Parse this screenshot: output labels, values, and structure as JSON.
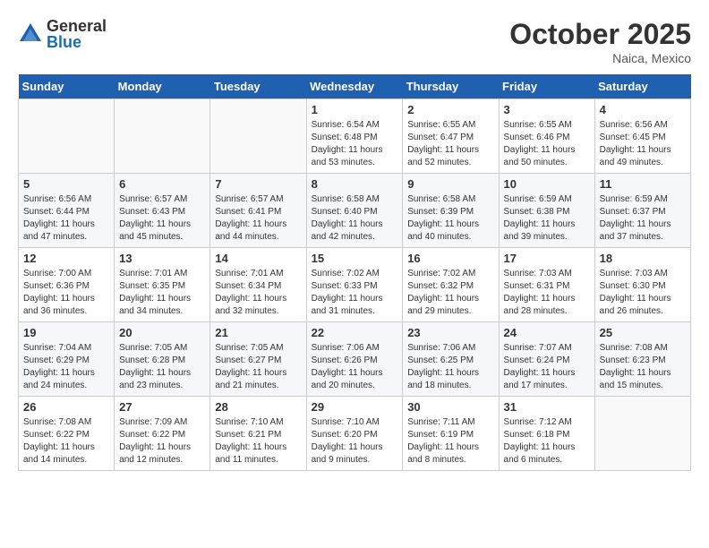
{
  "logo": {
    "general": "General",
    "blue": "Blue"
  },
  "header": {
    "month": "October 2025",
    "location": "Naica, Mexico"
  },
  "weekdays": [
    "Sunday",
    "Monday",
    "Tuesday",
    "Wednesday",
    "Thursday",
    "Friday",
    "Saturday"
  ],
  "weeks": [
    [
      {
        "day": "",
        "sunrise": "",
        "sunset": "",
        "daylight": ""
      },
      {
        "day": "",
        "sunrise": "",
        "sunset": "",
        "daylight": ""
      },
      {
        "day": "",
        "sunrise": "",
        "sunset": "",
        "daylight": ""
      },
      {
        "day": "1",
        "sunrise": "Sunrise: 6:54 AM",
        "sunset": "Sunset: 6:48 PM",
        "daylight": "Daylight: 11 hours and 53 minutes."
      },
      {
        "day": "2",
        "sunrise": "Sunrise: 6:55 AM",
        "sunset": "Sunset: 6:47 PM",
        "daylight": "Daylight: 11 hours and 52 minutes."
      },
      {
        "day": "3",
        "sunrise": "Sunrise: 6:55 AM",
        "sunset": "Sunset: 6:46 PM",
        "daylight": "Daylight: 11 hours and 50 minutes."
      },
      {
        "day": "4",
        "sunrise": "Sunrise: 6:56 AM",
        "sunset": "Sunset: 6:45 PM",
        "daylight": "Daylight: 11 hours and 49 minutes."
      }
    ],
    [
      {
        "day": "5",
        "sunrise": "Sunrise: 6:56 AM",
        "sunset": "Sunset: 6:44 PM",
        "daylight": "Daylight: 11 hours and 47 minutes."
      },
      {
        "day": "6",
        "sunrise": "Sunrise: 6:57 AM",
        "sunset": "Sunset: 6:43 PM",
        "daylight": "Daylight: 11 hours and 45 minutes."
      },
      {
        "day": "7",
        "sunrise": "Sunrise: 6:57 AM",
        "sunset": "Sunset: 6:41 PM",
        "daylight": "Daylight: 11 hours and 44 minutes."
      },
      {
        "day": "8",
        "sunrise": "Sunrise: 6:58 AM",
        "sunset": "Sunset: 6:40 PM",
        "daylight": "Daylight: 11 hours and 42 minutes."
      },
      {
        "day": "9",
        "sunrise": "Sunrise: 6:58 AM",
        "sunset": "Sunset: 6:39 PM",
        "daylight": "Daylight: 11 hours and 40 minutes."
      },
      {
        "day": "10",
        "sunrise": "Sunrise: 6:59 AM",
        "sunset": "Sunset: 6:38 PM",
        "daylight": "Daylight: 11 hours and 39 minutes."
      },
      {
        "day": "11",
        "sunrise": "Sunrise: 6:59 AM",
        "sunset": "Sunset: 6:37 PM",
        "daylight": "Daylight: 11 hours and 37 minutes."
      }
    ],
    [
      {
        "day": "12",
        "sunrise": "Sunrise: 7:00 AM",
        "sunset": "Sunset: 6:36 PM",
        "daylight": "Daylight: 11 hours and 36 minutes."
      },
      {
        "day": "13",
        "sunrise": "Sunrise: 7:01 AM",
        "sunset": "Sunset: 6:35 PM",
        "daylight": "Daylight: 11 hours and 34 minutes."
      },
      {
        "day": "14",
        "sunrise": "Sunrise: 7:01 AM",
        "sunset": "Sunset: 6:34 PM",
        "daylight": "Daylight: 11 hours and 32 minutes."
      },
      {
        "day": "15",
        "sunrise": "Sunrise: 7:02 AM",
        "sunset": "Sunset: 6:33 PM",
        "daylight": "Daylight: 11 hours and 31 minutes."
      },
      {
        "day": "16",
        "sunrise": "Sunrise: 7:02 AM",
        "sunset": "Sunset: 6:32 PM",
        "daylight": "Daylight: 11 hours and 29 minutes."
      },
      {
        "day": "17",
        "sunrise": "Sunrise: 7:03 AM",
        "sunset": "Sunset: 6:31 PM",
        "daylight": "Daylight: 11 hours and 28 minutes."
      },
      {
        "day": "18",
        "sunrise": "Sunrise: 7:03 AM",
        "sunset": "Sunset: 6:30 PM",
        "daylight": "Daylight: 11 hours and 26 minutes."
      }
    ],
    [
      {
        "day": "19",
        "sunrise": "Sunrise: 7:04 AM",
        "sunset": "Sunset: 6:29 PM",
        "daylight": "Daylight: 11 hours and 24 minutes."
      },
      {
        "day": "20",
        "sunrise": "Sunrise: 7:05 AM",
        "sunset": "Sunset: 6:28 PM",
        "daylight": "Daylight: 11 hours and 23 minutes."
      },
      {
        "day": "21",
        "sunrise": "Sunrise: 7:05 AM",
        "sunset": "Sunset: 6:27 PM",
        "daylight": "Daylight: 11 hours and 21 minutes."
      },
      {
        "day": "22",
        "sunrise": "Sunrise: 7:06 AM",
        "sunset": "Sunset: 6:26 PM",
        "daylight": "Daylight: 11 hours and 20 minutes."
      },
      {
        "day": "23",
        "sunrise": "Sunrise: 7:06 AM",
        "sunset": "Sunset: 6:25 PM",
        "daylight": "Daylight: 11 hours and 18 minutes."
      },
      {
        "day": "24",
        "sunrise": "Sunrise: 7:07 AM",
        "sunset": "Sunset: 6:24 PM",
        "daylight": "Daylight: 11 hours and 17 minutes."
      },
      {
        "day": "25",
        "sunrise": "Sunrise: 7:08 AM",
        "sunset": "Sunset: 6:23 PM",
        "daylight": "Daylight: 11 hours and 15 minutes."
      }
    ],
    [
      {
        "day": "26",
        "sunrise": "Sunrise: 7:08 AM",
        "sunset": "Sunset: 6:22 PM",
        "daylight": "Daylight: 11 hours and 14 minutes."
      },
      {
        "day": "27",
        "sunrise": "Sunrise: 7:09 AM",
        "sunset": "Sunset: 6:22 PM",
        "daylight": "Daylight: 11 hours and 12 minutes."
      },
      {
        "day": "28",
        "sunrise": "Sunrise: 7:10 AM",
        "sunset": "Sunset: 6:21 PM",
        "daylight": "Daylight: 11 hours and 11 minutes."
      },
      {
        "day": "29",
        "sunrise": "Sunrise: 7:10 AM",
        "sunset": "Sunset: 6:20 PM",
        "daylight": "Daylight: 11 hours and 9 minutes."
      },
      {
        "day": "30",
        "sunrise": "Sunrise: 7:11 AM",
        "sunset": "Sunset: 6:19 PM",
        "daylight": "Daylight: 11 hours and 8 minutes."
      },
      {
        "day": "31",
        "sunrise": "Sunrise: 7:12 AM",
        "sunset": "Sunset: 6:18 PM",
        "daylight": "Daylight: 11 hours and 6 minutes."
      },
      {
        "day": "",
        "sunrise": "",
        "sunset": "",
        "daylight": ""
      }
    ]
  ]
}
